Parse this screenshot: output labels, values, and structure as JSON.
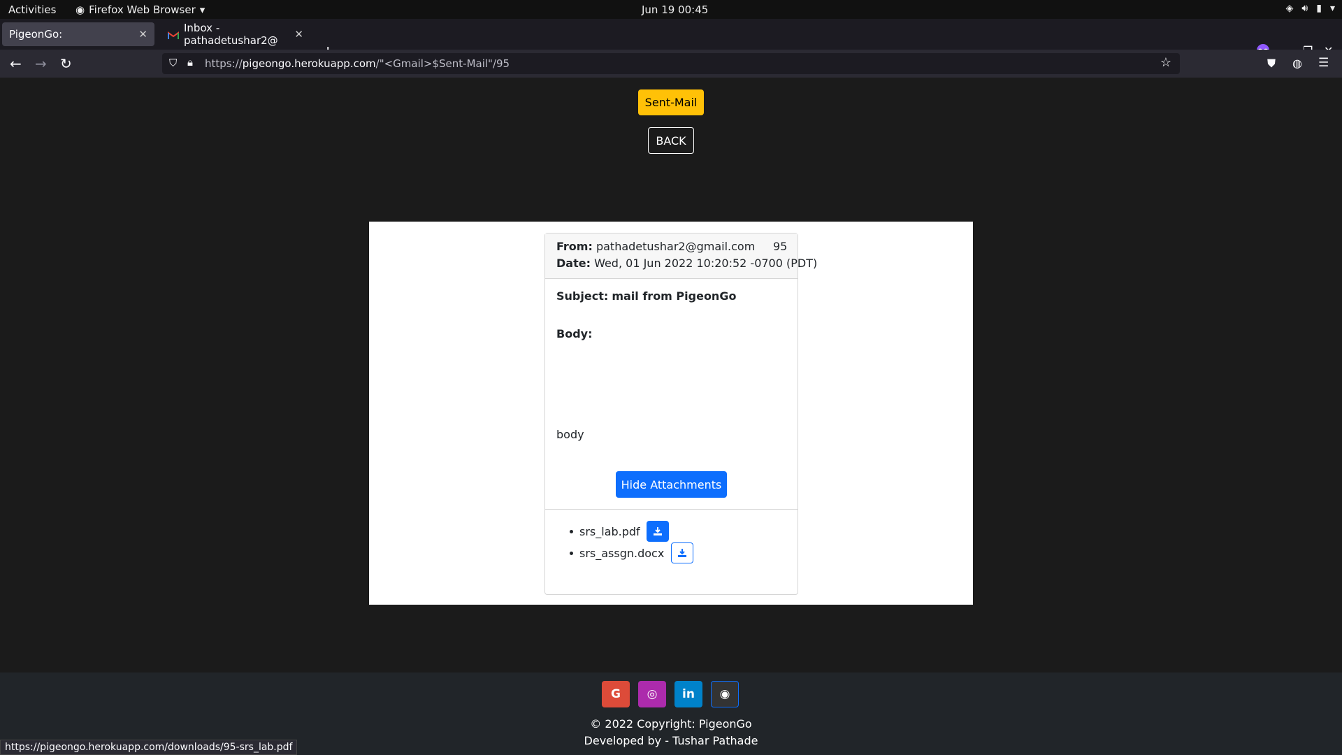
{
  "os": {
    "activities": "Activities",
    "app_name": "Firefox Web Browser",
    "clock": "Jun 19  00:45"
  },
  "browser": {
    "tabs": [
      {
        "label": "PigeonGo:"
      },
      {
        "label": "Inbox - pathadetushar2@"
      }
    ],
    "url_prefix": "https://",
    "url_domain": "pigeongo.herokuapp.com",
    "url_path": "/\"<Gmail>$Sent-Mail\"/95",
    "status_url": "https://pigeongo.herokuapp.com/downloads/95-srs_lab.pdf"
  },
  "page": {
    "sent_mail_label": "Sent-Mail",
    "back_label": "BACK",
    "mail": {
      "from_label": "From:",
      "from": "pathadetushar2@gmail.com",
      "id": "95",
      "date_label": "Date:",
      "date": "Wed, 01 Jun 2022 10:20:52 -0700 (PDT)",
      "subject_label": "Subject:",
      "subject": "mail from PigeonGo",
      "body_label": "Body:",
      "body": "body",
      "hide_attachments_label": "Hide Attachments",
      "attachments": [
        {
          "name": "srs_lab.pdf"
        },
        {
          "name": "srs_assgn.docx"
        }
      ]
    }
  },
  "footer": {
    "social": [
      {
        "name": "google",
        "glyph": "G",
        "color": "#dd4b39"
      },
      {
        "name": "instagram",
        "glyph": "◎",
        "color": "#ac2bac"
      },
      {
        "name": "linkedin",
        "glyph": "in",
        "color": "#0082ca"
      },
      {
        "name": "github",
        "glyph": "◉",
        "color": "#333333"
      }
    ],
    "copyright": "© 2022 Copyright: PigeonGo",
    "developer": "Developed by - Tushar Pathade"
  },
  "colors": {
    "warning": "#ffc107",
    "primary": "#0d6efd",
    "page_bg": "#1b1b1b"
  }
}
